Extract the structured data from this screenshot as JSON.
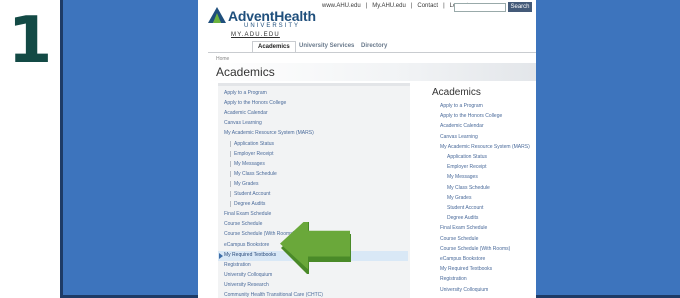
{
  "step_number": "1",
  "header": {
    "top_links": [
      "www.AHU.edu",
      "|",
      "My.AHU.edu",
      "|",
      "Contact",
      "|",
      "Logout"
    ],
    "search_button": "Search",
    "brand_name": "AdventHealth",
    "brand_sub": "UNIVERSITY",
    "brand_url": "MY.ADU.EDU"
  },
  "nav": {
    "tabs": [
      "Academics",
      "University Services",
      "Directory"
    ]
  },
  "breadcrumb": "Home",
  "page_title": "Academics",
  "sidebar": {
    "items": [
      "Apply to a Program",
      "Apply to the Honors College",
      "Academic Calendar",
      "Canvas Learning",
      "My Academic Resource System (MARS)",
      "Application Status",
      "Employer Receipt",
      "My Messages",
      "My Class Schedule",
      "My Grades",
      "Student Account",
      "Degree Audits",
      "Final Exam Schedule",
      "Course Schedule",
      "Course Schedule (With Rooms)",
      "eCampus Bookstore",
      "My Required Textbooks",
      "Registration",
      "University Colloquium",
      "University Research",
      "Community Health Transitional Care (CHTC)"
    ]
  },
  "content": {
    "title": "Academics",
    "items": [
      "Apply to a Program",
      "Apply to the Honors College",
      "Academic Calendar",
      "Canvas Learning",
      "My Academic Resource System (MARS)",
      "Application Status",
      "Employer Receipt",
      "My Messages",
      "My Class Schedule",
      "My Grades",
      "Student Account",
      "Degree Audits",
      "Final Exam Schedule",
      "Course Schedule",
      "Course Schedule (With Rooms)",
      "eCampus Bookstore",
      "My Required Textbooks",
      "Registration",
      "University Colloquium"
    ]
  },
  "colors": {
    "frame": "#3d74bd",
    "step_number": "#134a45",
    "link": "#4a6a9a",
    "arrow": "#6aa83a",
    "highlight": "#d9e8f6"
  }
}
